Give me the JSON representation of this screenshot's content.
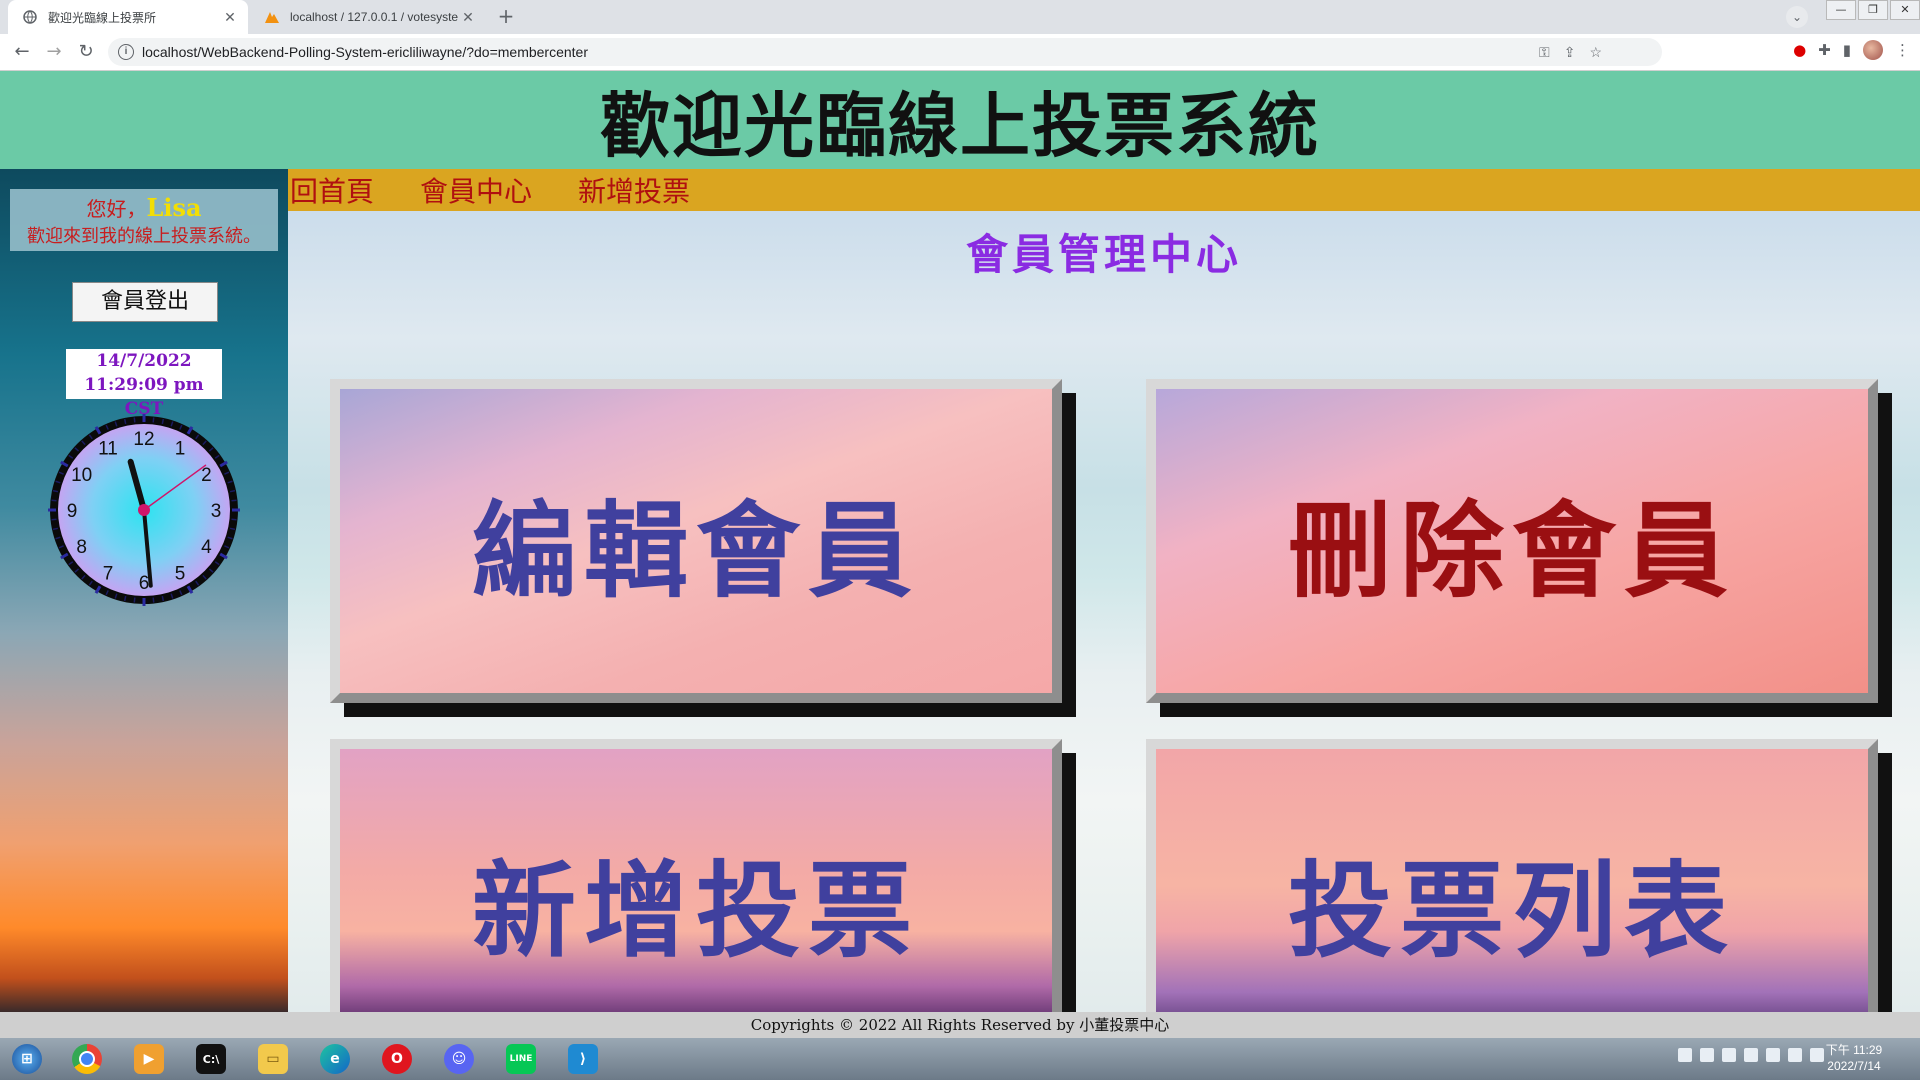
{
  "browser": {
    "tabs": [
      {
        "title": "歡迎光臨線上投票所",
        "active": true
      },
      {
        "title": "localhost / 127.0.0.1 / votesyste",
        "active": false
      }
    ],
    "new_tab": "+",
    "window_controls": [
      "—",
      "❐",
      "✕"
    ],
    "url": "localhost/WebBackend-Polling-System-ericliliwayne/?do=membercenter"
  },
  "header": {
    "title": "歡迎光臨線上投票系統"
  },
  "sidebar": {
    "greeting": "您好，",
    "user_name": "Lisa",
    "welcome": "歡迎來到我的線上投票系統。",
    "logout_label": "會員登出",
    "date": "14/7/2022",
    "time": "11:29:09 pm CST",
    "clock_numbers": [
      "12",
      "1",
      "2",
      "3",
      "4",
      "5",
      "6",
      "7",
      "8",
      "9",
      "10",
      "11"
    ],
    "clock_time": {
      "hour": 11,
      "minute": 29,
      "second": 9
    }
  },
  "nav": {
    "items": [
      {
        "label": "回首頁"
      },
      {
        "label": "會員中心"
      },
      {
        "label": "新增投票"
      }
    ]
  },
  "main": {
    "section_title": "會員管理中心",
    "cards": [
      {
        "label": "編輯會員",
        "color": "#40409e"
      },
      {
        "label": "刪除會員",
        "color": "#9a0f12"
      },
      {
        "label": "新增投票",
        "color": "#40409e"
      },
      {
        "label": "投票列表",
        "color": "#40409e"
      }
    ]
  },
  "footer": {
    "prefix": "Copyrights © 2022 All Rights Reserved by ",
    "owner": "小董投票中心"
  },
  "taskbar": {
    "apps": [
      "chrome-icon",
      "media-icon",
      "terminal-icon",
      "folder-icon",
      "edge-icon",
      "opera-icon",
      "discord-icon",
      "line-icon",
      "vscode-icon"
    ],
    "time": "下午 11:29",
    "date": "2022/7/14"
  },
  "colors": {
    "header_bg": "#6bcaa6",
    "nav_bg": "#daa520",
    "nav_text": "#b01010",
    "section_title": "#8a2be2",
    "date_text": "#7d16bf"
  }
}
